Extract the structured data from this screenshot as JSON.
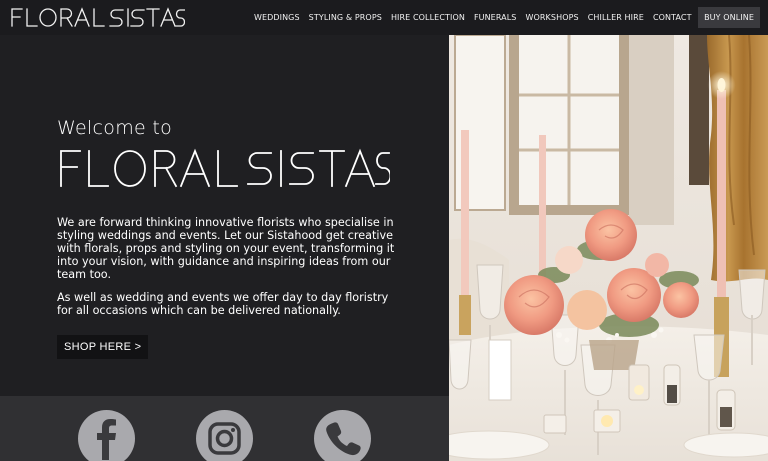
{
  "header": {
    "logo_text": "FLORAL SISTAS",
    "nav": [
      "WEDDINGS",
      "STYLING & PROPS",
      "HIRE COLLECTION",
      "FUNERALS",
      "WORKSHOPS",
      "CHILLER HIRE",
      "CONTACT",
      "BUY ONLINE"
    ]
  },
  "hero": {
    "welcome": "Welcome to",
    "brand": "FLORAL SISTAS",
    "paragraph1": "We are forward thinking innovative florists who specialise in styling weddings and events. Let our Sistahood get creative with florals, props and styling on your event, transforming it into your vision, with guidance and inspiring ideas from our team too.",
    "paragraph2": "As well as wedding and events we offer day to day floristry for all occasions which can be delivered nationally.",
    "cta": "SHOP HERE >"
  },
  "social": {
    "icons": [
      "facebook-icon",
      "instagram-icon",
      "phone-icon"
    ]
  },
  "colors": {
    "page_bg": "#1f1f22",
    "topbar_bg": "#1b1b1e",
    "social_bg": "#303033",
    "icon_circle": "#a9a9ad",
    "buy_button_bg": "#3a3a3e"
  }
}
